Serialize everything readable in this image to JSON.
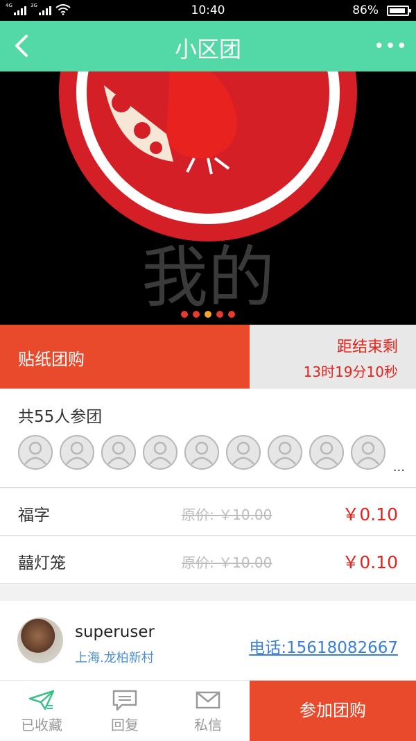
{
  "status_bar": {
    "time": "10:40",
    "battery": "86%",
    "net1": "4G",
    "net2": "3G"
  },
  "header": {
    "title": "小区团"
  },
  "banner": {
    "text": "我的",
    "dots": 5,
    "active_dot": 2
  },
  "deal": {
    "name": "贴纸团购",
    "countdown_label": "距结束剩",
    "countdown": "13时19分10秒"
  },
  "members": {
    "count_text": "共55人参团",
    "visible_avatars": 9,
    "more": "..."
  },
  "items": [
    {
      "name": "福字",
      "original_price": "原价: ￥10.00",
      "price": "￥0.10"
    },
    {
      "name": "囍灯笼",
      "original_price": "原价: ￥10.00",
      "price": "￥0.10"
    }
  ],
  "seller": {
    "username": "superuser",
    "location": "上海.龙柏新村",
    "phone": "电话:15618082667"
  },
  "bottom_bar": {
    "favorite": "已收藏",
    "reply": "回复",
    "message": "私信",
    "join": "参加团购"
  },
  "colors": {
    "accent_green": "#53d8a7",
    "primary_red": "#ea4a2c",
    "price_red": "#e3231c",
    "link_blue": "#3a7fd4"
  }
}
